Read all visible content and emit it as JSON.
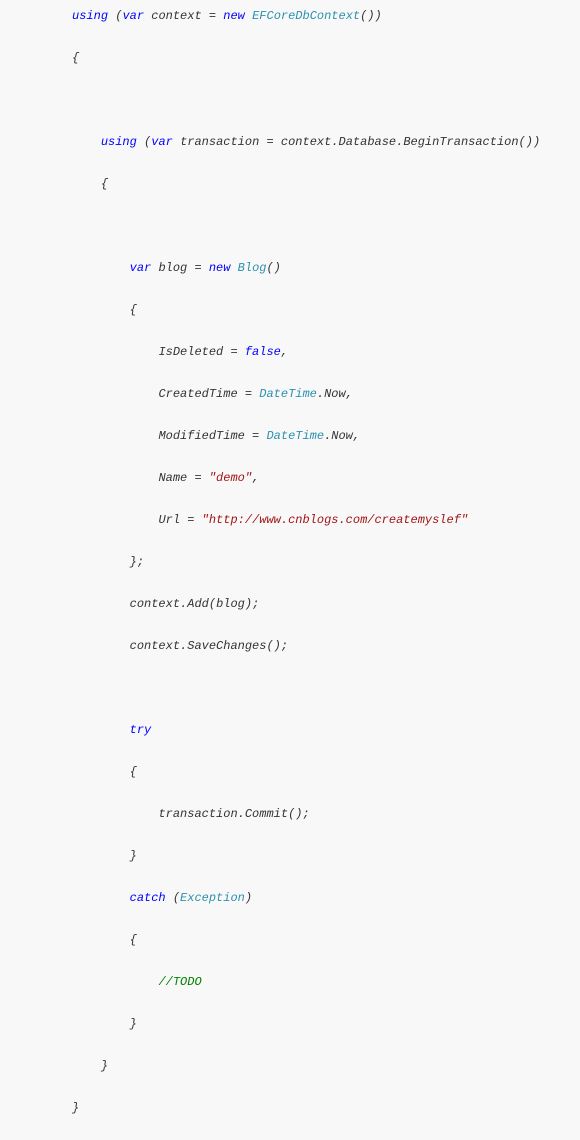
{
  "indent1": "          ",
  "indent2": "          ",
  "indent3": "              ",
  "indent4": "                  ",
  "indent5": "                      ",
  "kw": {
    "using": "using",
    "var": "var",
    "new": "new",
    "false": "false",
    "try": "try",
    "catch": "catch"
  },
  "types": {
    "dbcontext": "EFCoreDbContext",
    "blog": "Blog",
    "datetime": "DateTime",
    "exception": "Exception"
  },
  "ids": {
    "context": "context",
    "transaction": "transaction",
    "blog": "blog"
  },
  "members": {
    "database": "Database",
    "beginTransaction": "BeginTransaction",
    "now": "Now",
    "add": "Add",
    "savechanges": "SaveChanges",
    "commit": "Commit"
  },
  "props": {
    "isDeleted": "IsDeleted",
    "createdTime": "CreatedTime",
    "modifiedTime": "ModifiedTime",
    "name": "Name",
    "url": "Url"
  },
  "strings": {
    "demo": "\"demo\"",
    "url": "\"http://www.cnblogs.com/createmyslef\""
  },
  "comments": {
    "todo": "//TODO"
  },
  "sym": {
    "openParen": " (",
    "closeParenParen": "())",
    "closeParen": ")",
    "openBrace": "{",
    "closeBrace": "}",
    "closeBraceSemi": "};",
    "eq": " = ",
    "dot": ".",
    "comma": ",",
    "semi": ";",
    "parens": "()",
    "parensSemi": "();",
    "space": " "
  }
}
